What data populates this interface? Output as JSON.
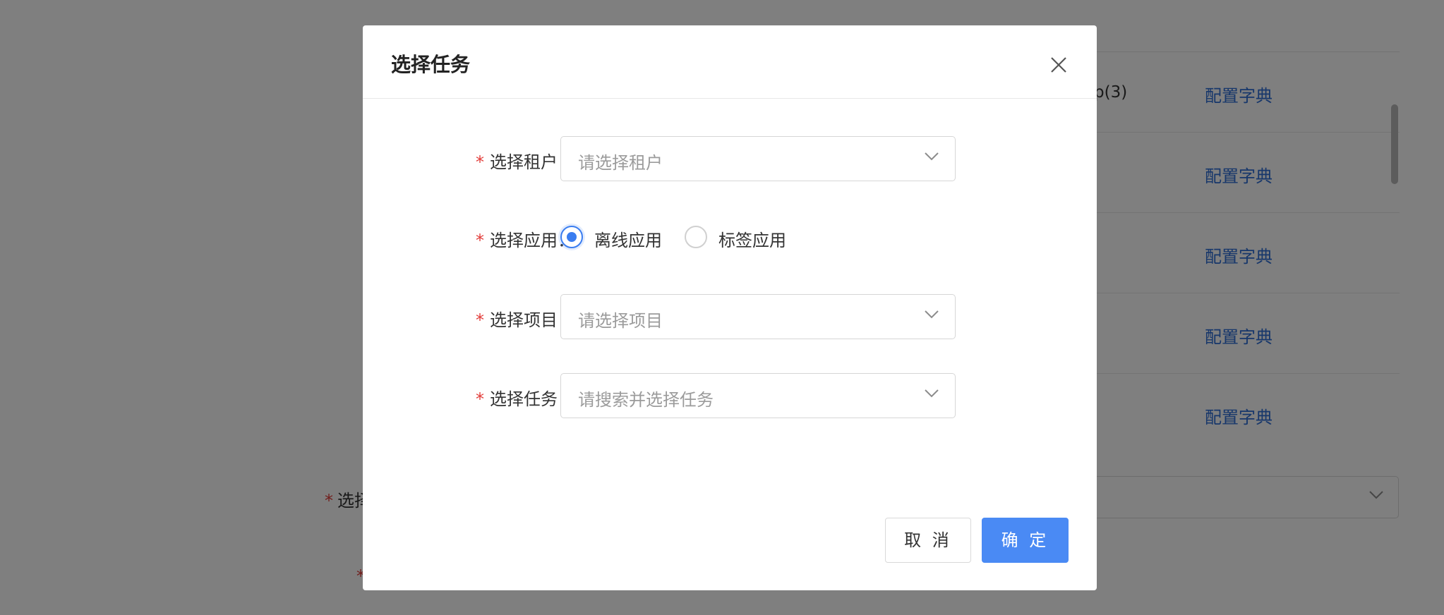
{
  "background": {
    "table": {
      "partial_text": "p(3)",
      "rows": [
        {
          "action": "配置字典"
        },
        {
          "action": "配置字典"
        },
        {
          "action": "配置字典"
        },
        {
          "action": "配置字典"
        },
        {
          "action": "配置字典"
        }
      ]
    },
    "form_label_partial": "选择",
    "required_mark": "*"
  },
  "modal": {
    "title": "选择任务",
    "fields": {
      "tenant": {
        "label": "选择租户：",
        "placeholder": "请选择租户"
      },
      "app": {
        "label": "选择应用：",
        "options": [
          {
            "label": "离线应用",
            "checked": true
          },
          {
            "label": "标签应用",
            "checked": false
          }
        ]
      },
      "project": {
        "label": "选择项目：",
        "placeholder": "请选择项目"
      },
      "task": {
        "label": "选择任务：",
        "placeholder": "请搜索并选择任务"
      }
    },
    "required_mark": "*",
    "buttons": {
      "cancel": "取 消",
      "ok": "确 定"
    }
  },
  "colors": {
    "primary": "#4a8af4",
    "link": "#2f6fd6",
    "required": "#e23c39",
    "mask": "rgba(0,0,0,0.5)"
  },
  "icons": {
    "close": "close-icon",
    "dropdown": "chevron-down-icon"
  }
}
